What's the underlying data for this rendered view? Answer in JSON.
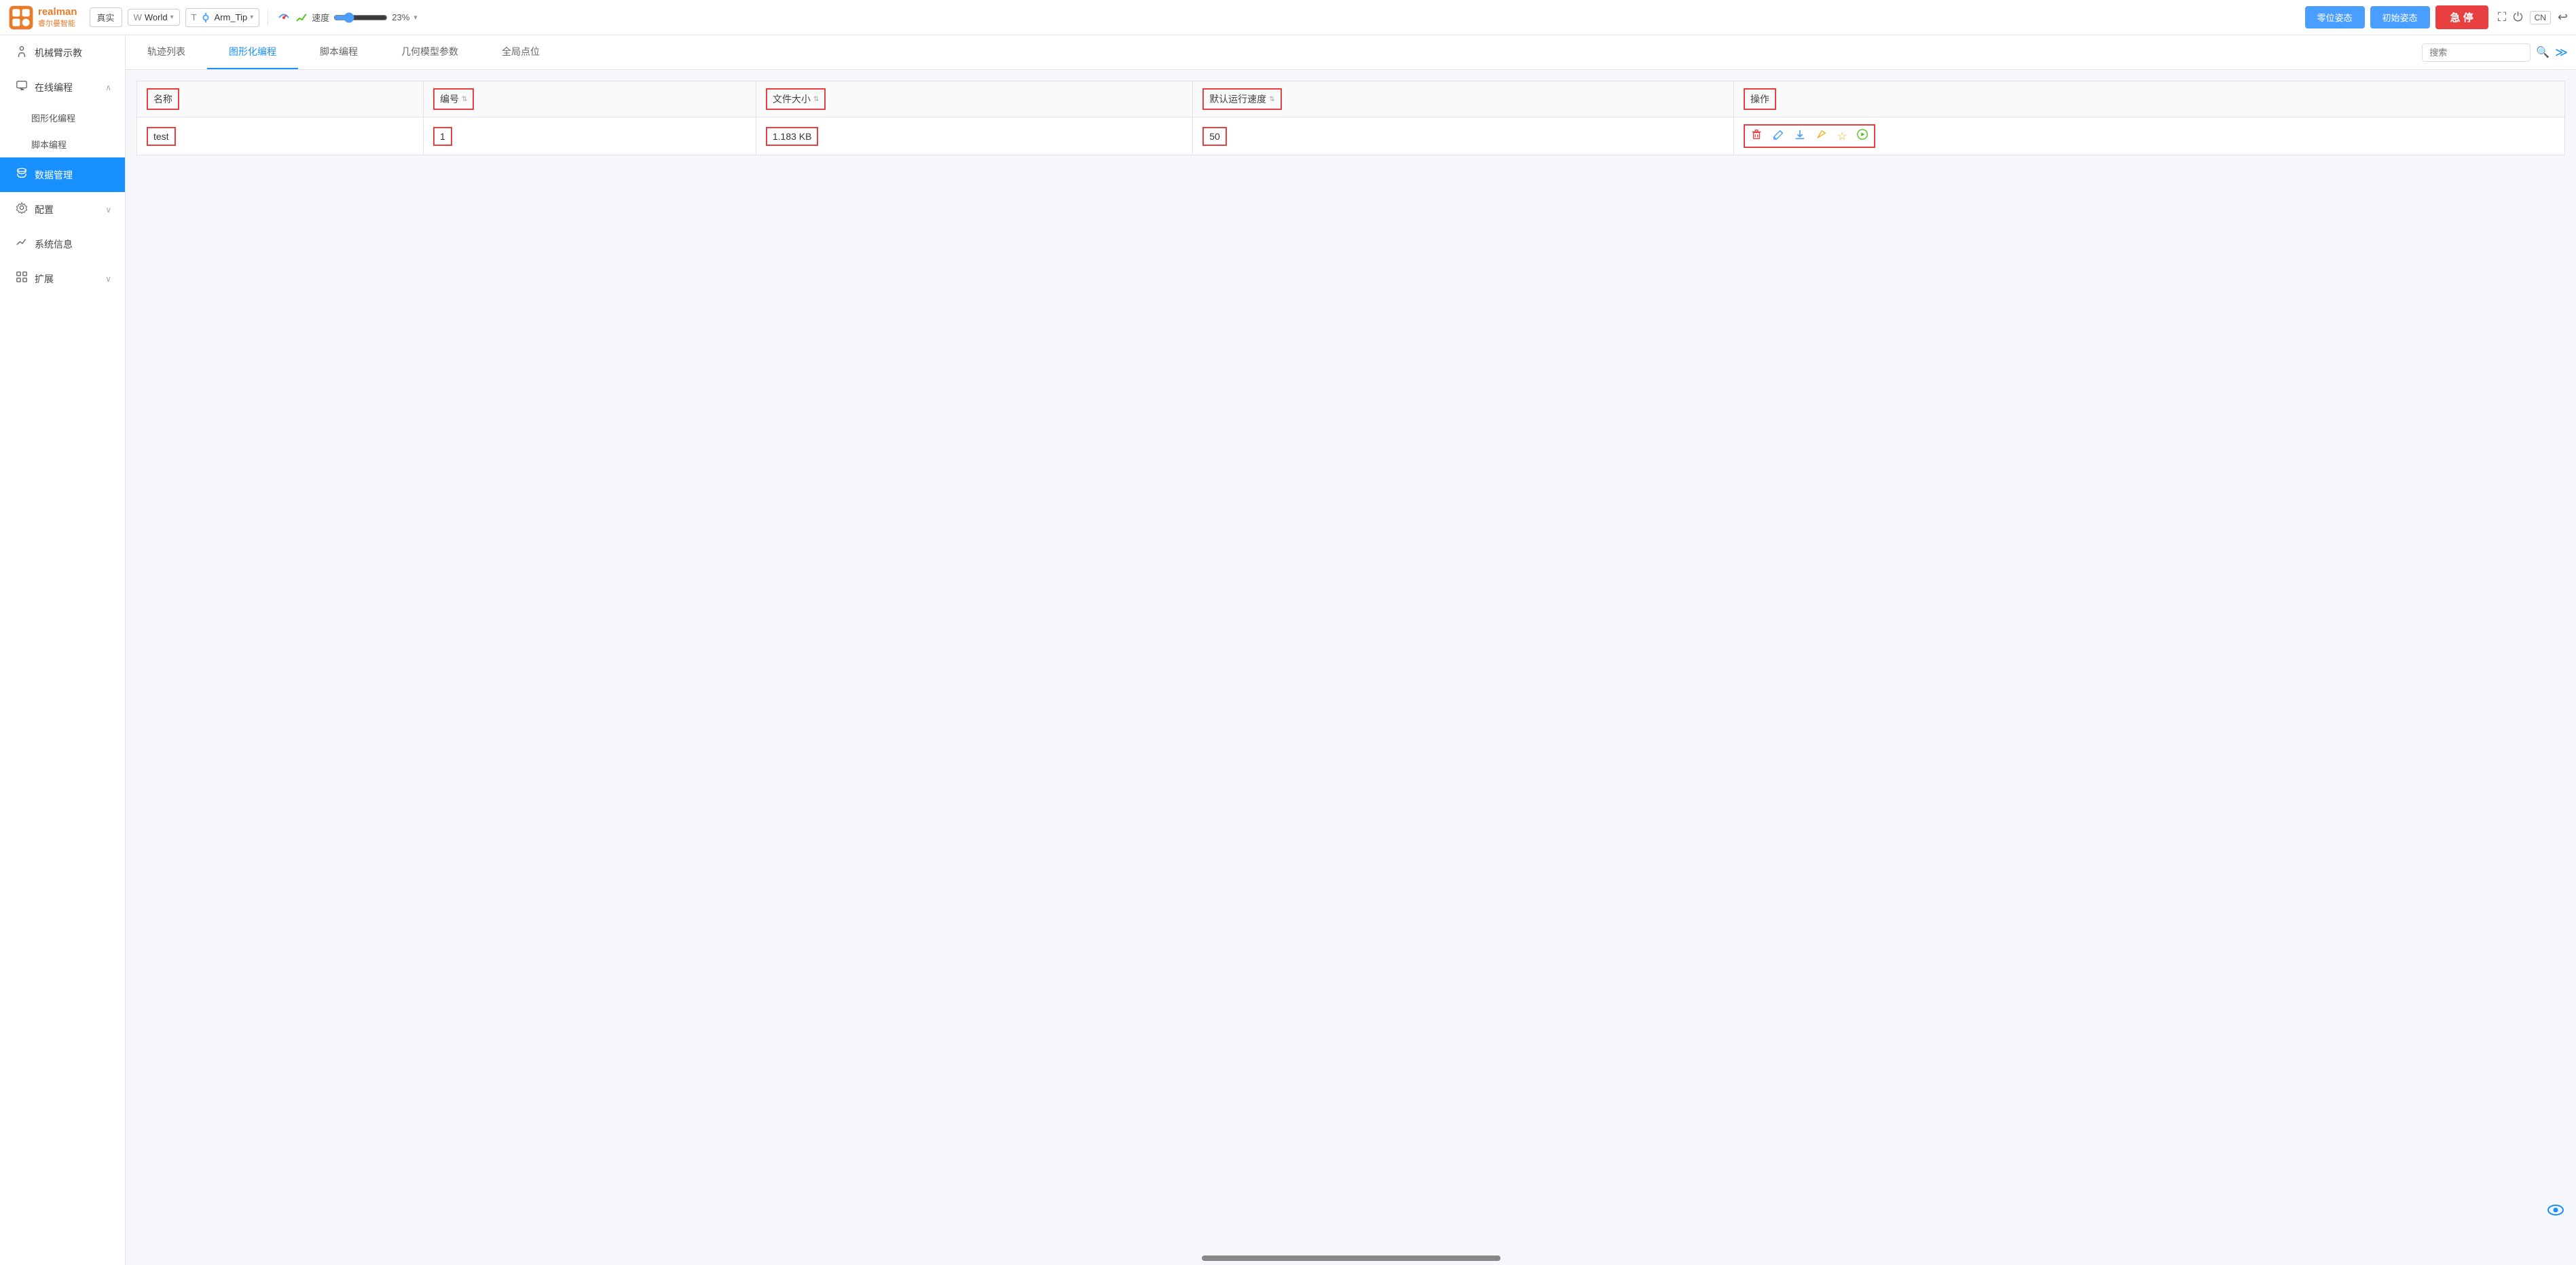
{
  "app": {
    "logo_text_line1": "睿尔曼智能",
    "title": "realman"
  },
  "topbar": {
    "mode_label": "真实",
    "world_label": "World",
    "tip_label": "Arm_Tip",
    "speed_label": "速度",
    "speed_value": 23,
    "speed_display": "23%",
    "btn_zero": "零位姿态",
    "btn_init": "初始姿态",
    "btn_stop": "急 停",
    "lang": "CN"
  },
  "sidebar": {
    "items": [
      {
        "id": "demo",
        "label": "机械臂示教",
        "icon": "🤖",
        "expandable": false
      },
      {
        "id": "online",
        "label": "在线编程",
        "icon": "💻",
        "expandable": true
      },
      {
        "id": "graphic",
        "label": "图形化编程",
        "icon": "",
        "sub": true
      },
      {
        "id": "script",
        "label": "脚本编程",
        "icon": "",
        "sub": true
      },
      {
        "id": "data",
        "label": "数据管理",
        "icon": "🗄",
        "expandable": false,
        "active": true
      },
      {
        "id": "config",
        "label": "配置",
        "icon": "⚙",
        "expandable": true
      },
      {
        "id": "sysinfo",
        "label": "系统信息",
        "icon": "📊",
        "expandable": false
      },
      {
        "id": "extend",
        "label": "扩展",
        "icon": "🧩",
        "expandable": true
      }
    ]
  },
  "tabs": [
    {
      "id": "trajectory",
      "label": "轨迹列表",
      "active": false
    },
    {
      "id": "graphic_prog",
      "label": "图形化编程",
      "active": true
    },
    {
      "id": "script_prog",
      "label": "脚本编程",
      "active": false
    },
    {
      "id": "geo_model",
      "label": "几何模型参数",
      "active": false
    },
    {
      "id": "global_pts",
      "label": "全局点位",
      "active": false
    }
  ],
  "table": {
    "columns": [
      {
        "id": "name",
        "label": "名称"
      },
      {
        "id": "number",
        "label": "编号",
        "sortable": true
      },
      {
        "id": "filesize",
        "label": "文件大小",
        "sortable": true
      },
      {
        "id": "speed",
        "label": "默认运行速度",
        "sortable": true
      },
      {
        "id": "actions",
        "label": "操作"
      }
    ],
    "rows": [
      {
        "name": "test",
        "number": "1",
        "filesize": "1.183 KB",
        "speed": "50"
      }
    ]
  },
  "actions": {
    "delete_label": "🗑",
    "edit_label": "✏",
    "download_label": "⬇",
    "pencil_label": "✏",
    "star_label": "☆",
    "play_label": "▶"
  },
  "search": {
    "placeholder": "搜索"
  }
}
